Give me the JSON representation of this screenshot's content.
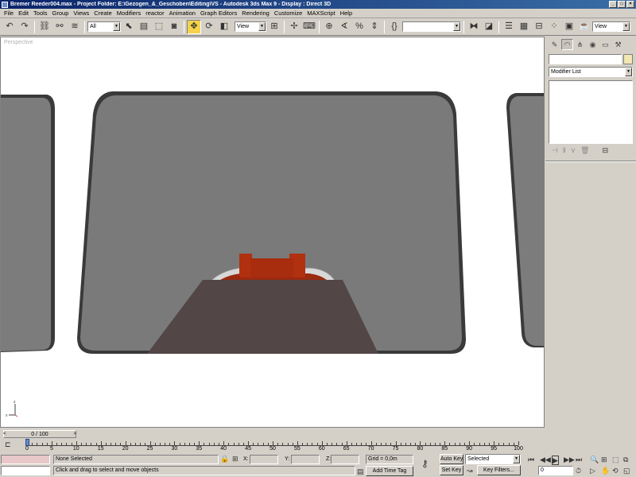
{
  "window": {
    "title": "Bremer Reeder004.max    - Project Folder: E:\\Gezogen_&_Geschoben\\Editing\\VS     - Autodesk 3ds Max 9      - Display : Direct 3D",
    "controls": [
      "_",
      "□",
      "×"
    ]
  },
  "menu": [
    "File",
    "Edit",
    "Tools",
    "Group",
    "Views",
    "Create",
    "Modifiers",
    "reactor",
    "Animation",
    "Graph Editors",
    "Rendering",
    "Customize",
    "MAXScript",
    "Help"
  ],
  "toolbar": {
    "selection_filter": "All",
    "reference_coord": "View",
    "named_selection": "",
    "view_dropdown": "View"
  },
  "viewport": {
    "label": "Perspective"
  },
  "command_panel": {
    "modifier_list": "Modifier List",
    "name_value": ""
  },
  "timeline": {
    "frame_display": "0 / 100",
    "ticks": [
      0,
      5,
      10,
      15,
      20,
      25,
      30,
      35,
      40,
      45,
      50,
      55,
      60,
      65,
      70,
      75,
      80,
      85,
      90,
      95,
      100
    ]
  },
  "status": {
    "selection_text": "None Selected",
    "prompt": "Click and drag to select and move objects",
    "x_label": "X:",
    "y_label": "Y:",
    "z_label": "Z:",
    "x_value": "",
    "y_value": "",
    "z_value": "",
    "grid": "Grid = 0,0m",
    "add_time_tag": "Add Time Tag",
    "auto_key": "Auto Key",
    "set_key": "Set Key",
    "selected_dropdown": "Selected",
    "key_filters": "Key Filters...",
    "current_frame": "0"
  },
  "colors": {
    "titlebar": "#0a246a",
    "viewport_bg": "#ffffff",
    "screen_gray": "#7a7a7a",
    "object_red": "#b03010",
    "ground_brown": "#524646",
    "active_tool": "#f5d24a"
  }
}
